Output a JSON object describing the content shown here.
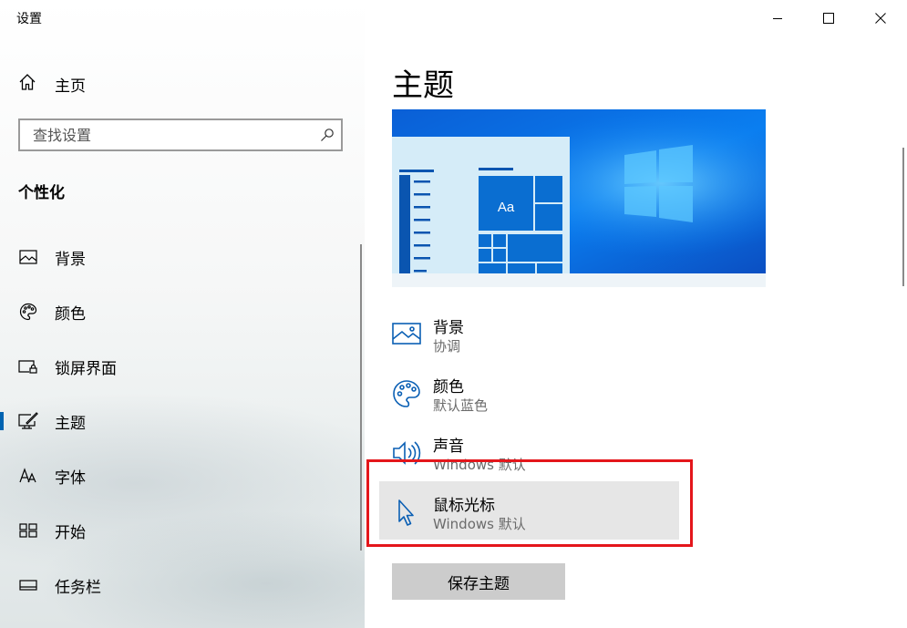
{
  "window": {
    "title": "设置",
    "controls": {
      "minimize": "minimize",
      "maximize": "maximize",
      "close": "close"
    }
  },
  "sidebar": {
    "home_label": "主页",
    "search": {
      "placeholder": "查找设置",
      "value": ""
    },
    "section_title": "个性化",
    "items": [
      {
        "label": "背景",
        "icon": "image-icon",
        "selected": false
      },
      {
        "label": "颜色",
        "icon": "palette-icon",
        "selected": false
      },
      {
        "label": "锁屏界面",
        "icon": "lock-screen-icon",
        "selected": false
      },
      {
        "label": "主题",
        "icon": "theme-brush-icon",
        "selected": true
      },
      {
        "label": "字体",
        "icon": "font-icon",
        "selected": false
      },
      {
        "label": "开始",
        "icon": "start-icon",
        "selected": false
      },
      {
        "label": "任务栏",
        "icon": "taskbar-icon",
        "selected": false
      }
    ]
  },
  "main": {
    "title": "主题",
    "preview": {
      "sample_text": "Aa"
    },
    "settings": [
      {
        "title": "背景",
        "value": "协调",
        "icon": "image-icon"
      },
      {
        "title": "颜色",
        "value": "默认蓝色",
        "icon": "palette-icon"
      },
      {
        "title": "声音",
        "value": "Windows 默认",
        "icon": "speaker-icon"
      },
      {
        "title": "鼠标光标",
        "value": "Windows 默认",
        "icon": "cursor-icon"
      }
    ],
    "save_button": "保存主题"
  },
  "colors": {
    "accent": "#0078d7",
    "highlight_border": "#e4161b",
    "selected_indicator": "#0063b1"
  }
}
